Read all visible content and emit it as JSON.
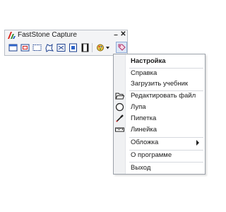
{
  "window": {
    "title": "FastStone Capture",
    "minimize_glyph": "–",
    "close_glyph": "✕"
  },
  "toolbar": {
    "tools": [
      {
        "name": "capture-active-window-icon"
      },
      {
        "name": "capture-window-object-icon"
      },
      {
        "name": "capture-rectangular-region-icon"
      },
      {
        "name": "capture-freehand-region-icon"
      },
      {
        "name": "capture-full-screen-icon"
      },
      {
        "name": "capture-scrolling-window-icon"
      },
      {
        "name": "screen-recorder-icon"
      },
      {
        "name": "output-destination-icon"
      },
      {
        "name": "settings-menu-icon"
      }
    ]
  },
  "menu": {
    "items": [
      {
        "label": "Настройка",
        "bold": true
      },
      {
        "label": "Справка"
      },
      {
        "label": "Загрузить учебник"
      },
      {
        "label": "Редактировать файл",
        "icon": "open-folder-icon"
      },
      {
        "label": "Лупа",
        "icon": "magnifier-icon"
      },
      {
        "label": "Пипетка",
        "icon": "eyedropper-icon"
      },
      {
        "label": "Линейка",
        "icon": "ruler-icon"
      },
      {
        "label": "Обложка",
        "submenu": true
      },
      {
        "label": "О программе"
      },
      {
        "label": "Выход"
      }
    ]
  },
  "colors": {
    "accent_selected": "#dde7f6",
    "logo_red": "#d9261c",
    "logo_green": "#2e8b2e"
  }
}
